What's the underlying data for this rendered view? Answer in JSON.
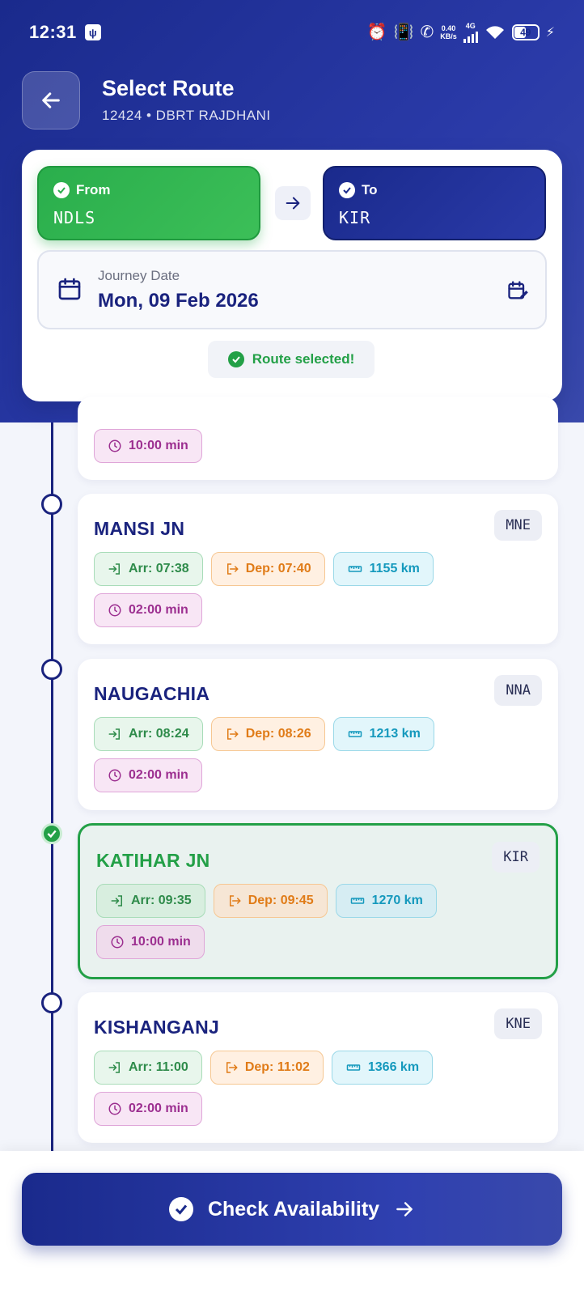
{
  "status_bar": {
    "time": "12:31",
    "net_speed_value": "0.40",
    "net_speed_unit": "KB/s",
    "network_type": "4G",
    "battery": "49"
  },
  "header": {
    "title": "Select Route",
    "subtitle": "12424 • DBRT RAJDHANI"
  },
  "route": {
    "from_label": "From",
    "from_code": "NDLS",
    "to_label": "To",
    "to_code": "KIR",
    "date_label": "Journey Date",
    "date_value": "Mon, 09 Feb 2026",
    "status_text": "Route selected!"
  },
  "stops": [
    {
      "name": "",
      "code": "",
      "halt": "10:00 min"
    },
    {
      "name": "MANSI JN",
      "code": "MNE",
      "arr": "Arr: 07:38",
      "dep": "Dep: 07:40",
      "dist": "1155 km",
      "halt": "02:00 min"
    },
    {
      "name": "NAUGACHIA",
      "code": "NNA",
      "arr": "Arr: 08:24",
      "dep": "Dep: 08:26",
      "dist": "1213 km",
      "halt": "02:00 min"
    },
    {
      "name": "KATIHAR JN",
      "code": "KIR",
      "arr": "Arr: 09:35",
      "dep": "Dep: 09:45",
      "dist": "1270 km",
      "halt": "10:00 min"
    },
    {
      "name": "KISHANGANJ",
      "code": "KNE",
      "arr": "Arr: 11:00",
      "dep": "Dep: 11:02",
      "dist": "1366 km",
      "halt": "02:00 min"
    }
  ],
  "cta": {
    "label": "Check Availability"
  },
  "colors": {
    "primary": "#1a237e",
    "success": "#23a047",
    "arrival": "#2e8b4a",
    "departure": "#e07b17",
    "distance": "#1599bd",
    "halt": "#9c2f90"
  },
  "icons": {
    "back": "arrow-left-icon",
    "calendar": "calendar-icon",
    "edit_date": "calendar-edit-icon",
    "arrival": "login-arrow-icon",
    "departure": "logout-arrow-icon",
    "distance": "ruler-icon",
    "halt": "clock-icon"
  }
}
